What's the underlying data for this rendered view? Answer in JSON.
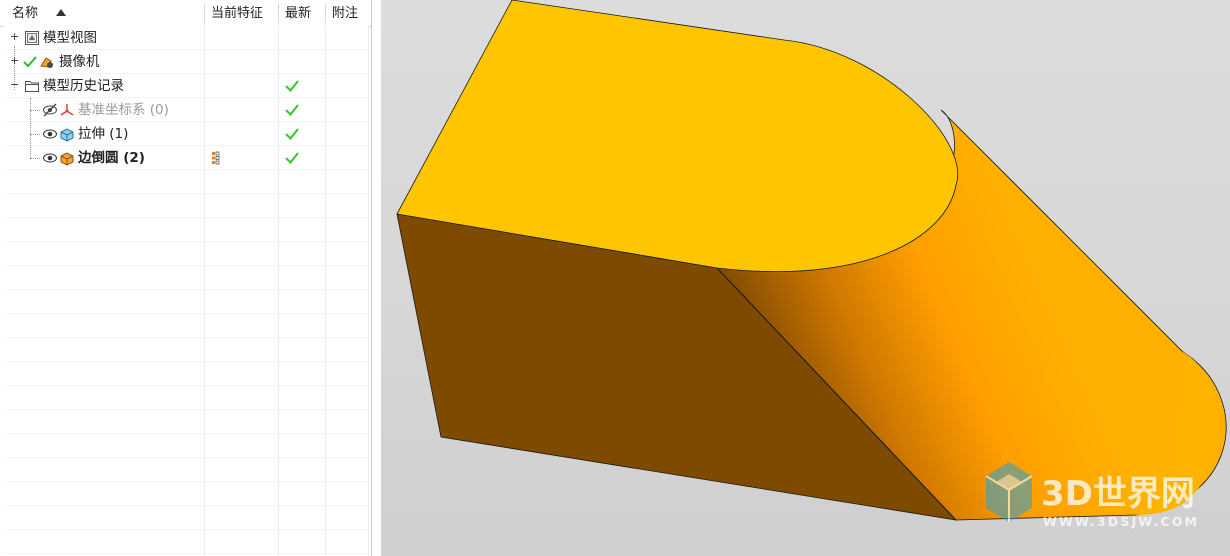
{
  "tree": {
    "columns": {
      "name": "名称",
      "current_feature": "当前特征",
      "latest": "最新",
      "notes": "附注"
    },
    "rows": [
      {
        "label": "模型视图",
        "icon": "model-views-icon",
        "expandable": true,
        "latest": false
      },
      {
        "label": "摄像机",
        "icon": "camera-icon",
        "expandable": true,
        "latest": false
      },
      {
        "label": "模型历史记录",
        "icon": "folder-icon",
        "expandable": true,
        "latest": true
      },
      {
        "label": "基准坐标系 (0)",
        "icon": "datum-csys-icon",
        "latest": true,
        "hidden": true
      },
      {
        "label": "拉伸 (1)",
        "icon": "extrude-icon",
        "latest": true
      },
      {
        "label": "边倒圆 (2)",
        "icon": "edge-blend-icon",
        "latest": true,
        "current": true
      }
    ]
  },
  "viewport": {
    "watermark_text": "3D世界网",
    "watermark_url": "WWW.3DSJW.COM",
    "colors": {
      "top_face": "#ffc600",
      "front_face": "#7d4a00",
      "round_face": "#ff9f00",
      "background": "#d8d8d8"
    }
  }
}
